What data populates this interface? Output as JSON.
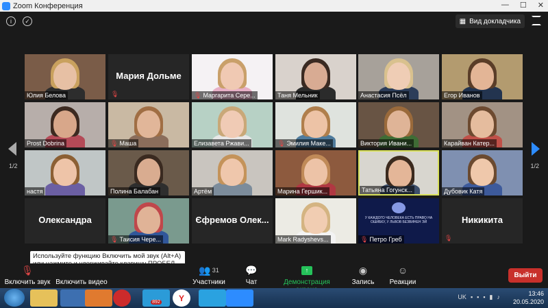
{
  "window": {
    "title": "Zoom Конференция",
    "minimize": "—",
    "maximize": "☐",
    "close": "✕"
  },
  "top": {
    "info": "i",
    "shield": "✓",
    "speaker_view": "Вид докладчика"
  },
  "pager": {
    "left": "1/2",
    "right": "1/2"
  },
  "participants": [
    {
      "name": "Юлия Белова",
      "muted": false,
      "bg": "#7a5c48",
      "skin": "#e7c0a4",
      "hair": "#c9a15e",
      "shirt": "#2d2d2d"
    },
    {
      "name": "Мария Дольме",
      "muted": true,
      "blank": true
    },
    {
      "name": "Маргарита Сере...",
      "muted": true,
      "bg": "#f5f2f4",
      "skin": "#f0c9b3",
      "hair": "#c9a06a",
      "shirt": "#e7b0c7"
    },
    {
      "name": "Таня Мельник",
      "muted": false,
      "bg": "#d9d2cc",
      "skin": "#d8ab93",
      "hair": "#3a2a22",
      "shirt": "#2b2b2b"
    },
    {
      "name": "Анастасия Псёл",
      "muted": false,
      "bg": "#a7a19a",
      "skin": "#efcdb5",
      "hair": "#d9c18e",
      "shirt": "#2c3d59"
    },
    {
      "name": "Егор Иванов",
      "muted": false,
      "bg": "#b39b6f",
      "skin": "#e3b596",
      "hair": "#5a3d28",
      "shirt": "#23344f"
    },
    {
      "name": "Prost Dobrina",
      "muted": false,
      "bg": "#b7aeaa",
      "skin": "#d8a78a",
      "hair": "#3d2a20",
      "shirt": "#b44a57"
    },
    {
      "name": "Маша",
      "muted": true,
      "bg": "#c9b9a3",
      "skin": "#e1b699",
      "hair": "#a06e44",
      "shirt": "#8a6d5b"
    },
    {
      "name": "Елизавета Ржави...",
      "muted": false,
      "bg": "#b7d1c5",
      "skin": "#f0cbb5",
      "hair": "#c9a878",
      "shirt": "#e7e7e7"
    },
    {
      "name": "Эмилия Маке...",
      "muted": true,
      "bg": "#dfe3de",
      "skin": "#edc3a6",
      "hair": "#b07f4c",
      "shirt": "#4f7b9c"
    },
    {
      "name": "Виктория Ивани...",
      "muted": false,
      "bg": "#685444",
      "skin": "#dfb497",
      "hair": "#9a6a3b",
      "shirt": "#3f6c35"
    },
    {
      "name": "Карайван Катер...",
      "muted": false,
      "bg": "#a29284",
      "skin": "#e5bc9e",
      "hair": "#6d4a30",
      "shirt": "#c05048"
    },
    {
      "name": "настя",
      "muted": false,
      "bg": "#c0c6c6",
      "skin": "#eec4a8",
      "hair": "#8c6034",
      "shirt": "#6b5fa3"
    },
    {
      "name": "Полина Балабан",
      "muted": false,
      "bg": "#6a5a4a",
      "skin": "#d9ac90",
      "hair": "#3a2a20",
      "shirt": "#2e2e2e"
    },
    {
      "name": "Артём",
      "muted": false,
      "bg": "#c9c5bf",
      "skin": "#efc7ac",
      "hair": "#c4935a",
      "shirt": "#7c8c9b"
    },
    {
      "name": "Марина Гершик...",
      "muted": false,
      "bg": "#8d5a3e",
      "skin": "#edc3a7",
      "hair": "#c08a58",
      "shirt": "#b03842"
    },
    {
      "name": "Татьяна Гогунск...",
      "muted": false,
      "active": true,
      "bg": "#d8d6cf",
      "skin": "#e4b698",
      "hair": "#3b2a1e",
      "shirt": "#3d4f6b"
    },
    {
      "name": "Дубовик Катя",
      "muted": false,
      "bg": "#7f90b1",
      "skin": "#efc8ab",
      "hair": "#6b4a30",
      "shirt": "#3d5a9b"
    },
    {
      "name": "Олександра",
      "muted": false,
      "blank": true
    },
    {
      "name": "Таисия Чере...",
      "muted": true,
      "bg": "#7a9a8e",
      "skin": "#e0b397",
      "hair": "#c0474b",
      "shirt": "#31579a"
    },
    {
      "name": "Єфремов Олек...",
      "muted": false,
      "blank": true
    },
    {
      "name": "Mark Radyshevs...",
      "muted": false,
      "bg": "#ecebe4",
      "skin": "#f1cdb2",
      "hair": "#d4b482",
      "shirt": "#f3f3f3"
    },
    {
      "name": "Петро Греб",
      "muted": true,
      "bg": "#0f1a4a",
      "poster": "У КАЖДОГО ЧЕЛОВЕКА ЕСТЬ ПРАВО НА ОШИБКУ, У ЛЬВОВ БЕЗВИНЕН ЭЙ"
    },
    {
      "name": "Никикита",
      "muted": true,
      "blank": true
    }
  ],
  "tooltip": "Используйте функцию Включить мой звук (Alt+A) или нажмите и удерживайте клавишу ПРОБЕЛ, чтобы временно включить звук.",
  "toolbar": {
    "unmute": "Включить звук",
    "video": "Включить видео",
    "participants": "Участники",
    "participants_count": "31",
    "chat": "Чат",
    "share": "Демонстрация экрана",
    "record": "Запись",
    "reactions": "Реакции",
    "leave": "Выйти"
  },
  "taskbar": {
    "badge": "892",
    "lang": "UK",
    "time": "13:46",
    "date": "20.05.2020"
  },
  "colors": {
    "accent": "#2d8cff",
    "share_green": "#25c25a",
    "leave_red": "#c8302b",
    "active_border": "#d8e05a"
  }
}
